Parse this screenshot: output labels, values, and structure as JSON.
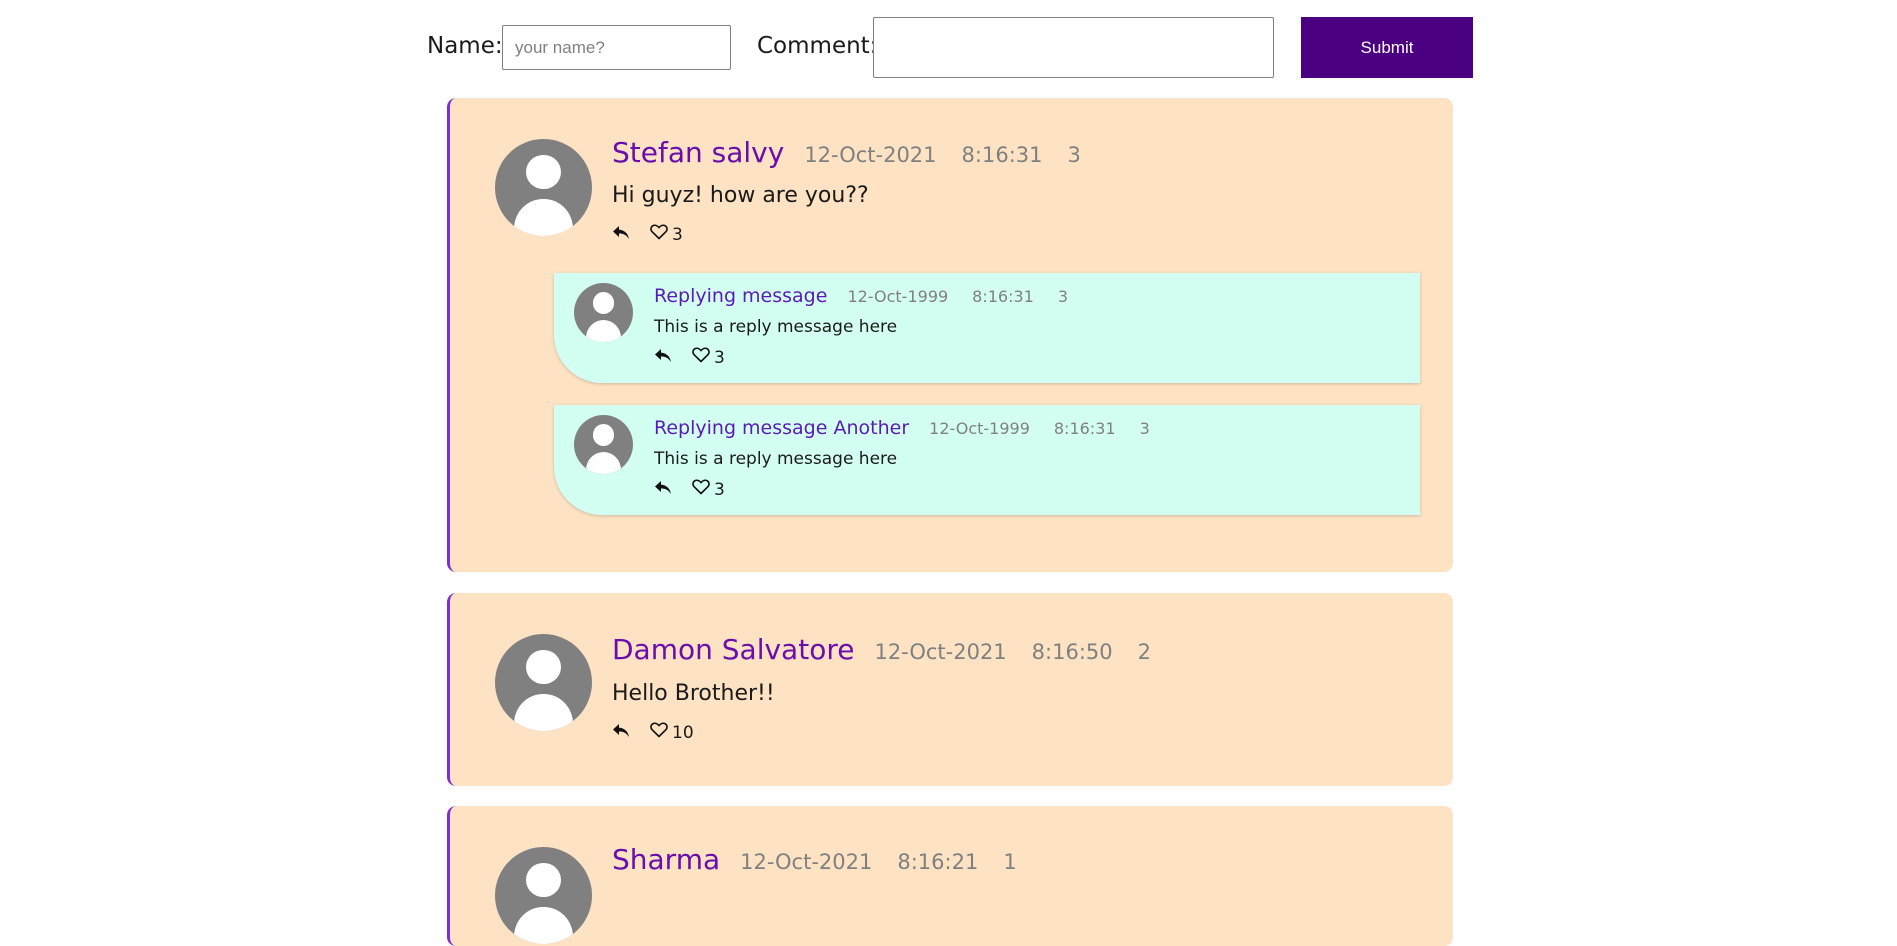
{
  "form": {
    "name_label": "Name:",
    "name_placeholder": "your name?",
    "name_value": "",
    "comment_label": "Comment:",
    "comment_value": "",
    "submit_label": "Submit"
  },
  "colors": {
    "accent": "#4b0082",
    "author": "#6a0dad",
    "card_bg": "#fde2c3",
    "reply_bg": "#d3fff3",
    "avatar": "#808080"
  },
  "comments": [
    {
      "author": "Stefan salvy",
      "date": "12-Oct-2021",
      "time": "8:16:31",
      "count": "3",
      "message": "Hi guyz! how are you??",
      "likes": "3",
      "replies": [
        {
          "author": "Replying message",
          "date": "12-Oct-1999",
          "time": "8:16:31",
          "count": "3",
          "message": "This is a reply message here",
          "likes": "3"
        },
        {
          "author": "Replying message Another",
          "date": "12-Oct-1999",
          "time": "8:16:31",
          "count": "3",
          "message": "This is a reply message here",
          "likes": "3"
        }
      ]
    },
    {
      "author": "Damon Salvatore",
      "date": "12-Oct-2021",
      "time": "8:16:50",
      "count": "2",
      "message": "Hello Brother!!",
      "likes": "10",
      "replies": []
    },
    {
      "author": "Sharma",
      "date": "12-Oct-2021",
      "time": "8:16:21",
      "count": "1",
      "replies": []
    }
  ],
  "icons": {
    "reply": "reply-arrow-icon",
    "like": "heart-outline-icon",
    "avatar": "user-avatar-icon"
  }
}
